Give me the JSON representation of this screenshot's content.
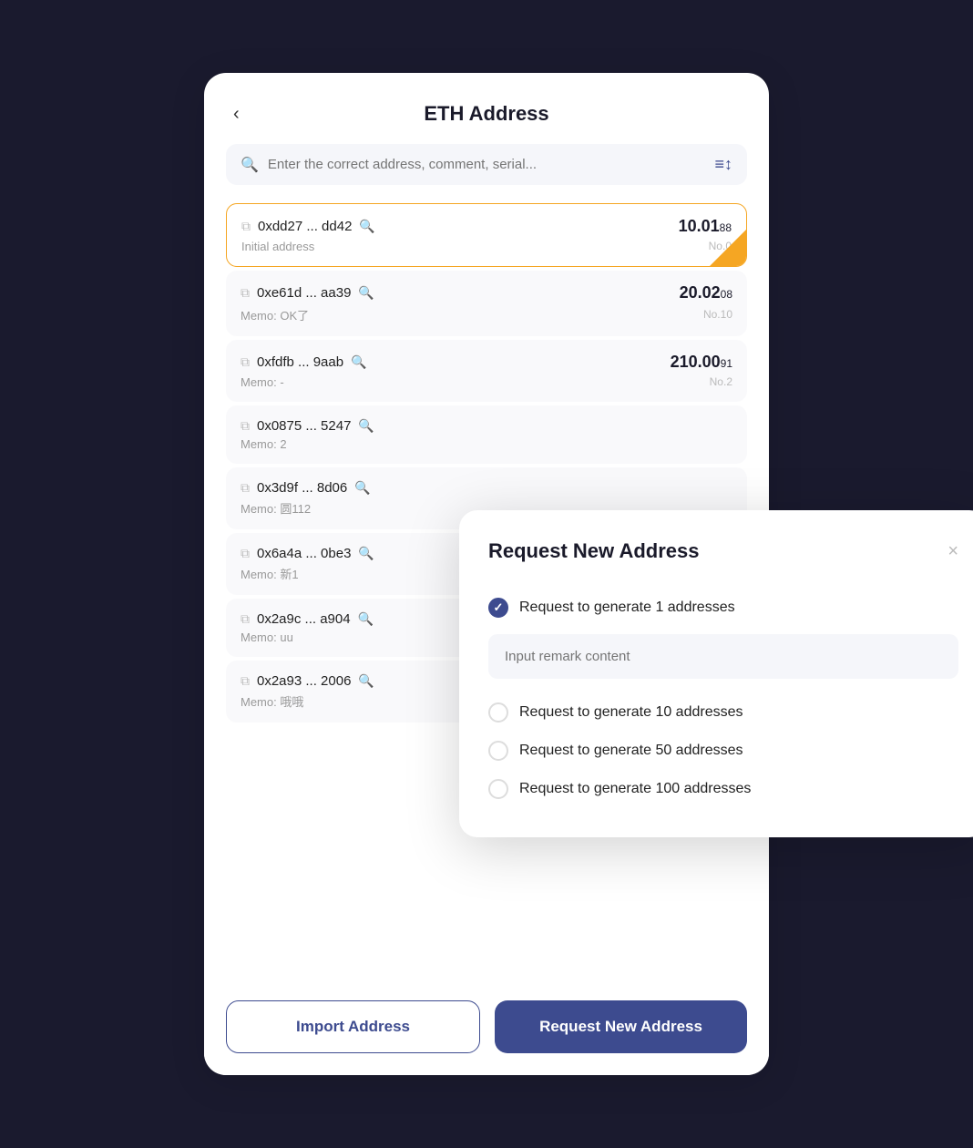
{
  "header": {
    "back_label": "‹",
    "title": "ETH Address"
  },
  "search": {
    "placeholder": "Enter the correct address, comment, serial...",
    "filter_icon": "≡↕"
  },
  "addresses": [
    {
      "addr": "0xdd27 ... dd42",
      "memo": "Initial address",
      "amount_big": "10.01",
      "amount_small": "88",
      "no": "No.0",
      "selected": true
    },
    {
      "addr": "0xe61d ... aa39",
      "memo": "Memo: OK了",
      "amount_big": "20.02",
      "amount_small": "08",
      "no": "No.10",
      "selected": false
    },
    {
      "addr": "0xfdfb ... 9aab",
      "memo": "Memo: -",
      "amount_big": "210.00",
      "amount_small": "91",
      "no": "No.2",
      "selected": false
    },
    {
      "addr": "0x0875 ... 5247",
      "memo": "Memo: 2",
      "amount_big": "",
      "amount_small": "",
      "no": "",
      "selected": false
    },
    {
      "addr": "0x3d9f ... 8d06",
      "memo": "Memo: 圆112",
      "amount_big": "",
      "amount_small": "",
      "no": "",
      "selected": false
    },
    {
      "addr": "0x6a4a ... 0be3",
      "memo": "Memo: 新1",
      "amount_big": "",
      "amount_small": "",
      "no": "",
      "selected": false
    },
    {
      "addr": "0x2a9c ... a904",
      "memo": "Memo: uu",
      "amount_big": "",
      "amount_small": "",
      "no": "",
      "selected": false
    },
    {
      "addr": "0x2a93 ... 2006",
      "memo": "Memo: 哦哦",
      "amount_big": "",
      "amount_small": "",
      "no": "",
      "selected": false
    }
  ],
  "buttons": {
    "import": "Import Address",
    "request": "Request New Address"
  },
  "modal": {
    "title": "Request New Address",
    "close": "×",
    "options": [
      {
        "label": "Request to generate 1 addresses",
        "checked": true
      },
      {
        "label": "Request to generate 10 addresses",
        "checked": false
      },
      {
        "label": "Request to generate 50 addresses",
        "checked": false
      },
      {
        "label": "Request to generate 100 addresses",
        "checked": false
      }
    ],
    "remark_placeholder": "Input remark content"
  }
}
